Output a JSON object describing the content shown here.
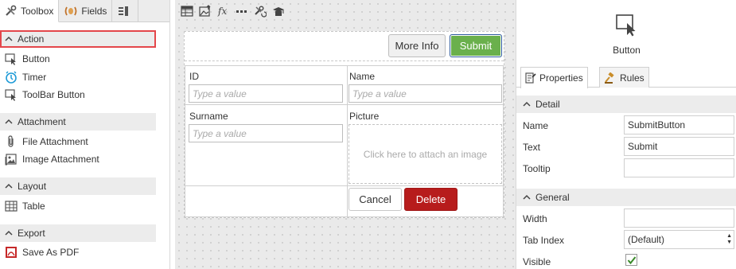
{
  "left_panel": {
    "tabs": [
      {
        "label": "Toolbox",
        "icon": "tools-icon"
      },
      {
        "label": "Fields",
        "icon": "fields-icon"
      },
      {
        "label": "",
        "icon": "list-icon"
      }
    ],
    "sections": [
      {
        "title": "Action",
        "items": [
          "Button",
          "Timer",
          "ToolBar Button"
        ]
      },
      {
        "title": "Attachment",
        "items": [
          "File Attachment",
          "Image Attachment"
        ]
      },
      {
        "title": "Layout",
        "items": [
          "Table"
        ]
      },
      {
        "title": "Export",
        "items": [
          "Save As PDF"
        ]
      }
    ]
  },
  "toolbar": {
    "icons": [
      "table-icon",
      "image-upload-icon",
      "fx-icon",
      "ellipsis-icon",
      "tools-refresh-icon",
      "graduate-icon"
    ]
  },
  "form": {
    "more_info_label": "More Info",
    "submit_label": "Submit",
    "id_label": "ID",
    "id_placeholder": "Type a value",
    "name_label": "Name",
    "name_placeholder": "Type a value",
    "surname_label": "Surname",
    "surname_placeholder": "Type a value",
    "picture_label": "Picture",
    "picture_placeholder": "Click here to attach an image",
    "cancel_label": "Cancel",
    "delete_label": "Delete"
  },
  "right_panel": {
    "control_label": "Button",
    "tabs": {
      "properties": "Properties",
      "rules": "Rules"
    },
    "detail_title": "Detail",
    "general_title": "General",
    "name_label": "Name",
    "name_value": "SubmitButton",
    "text_label": "Text",
    "text_value": "Submit",
    "tooltip_label": "Tooltip",
    "tooltip_value": "",
    "width_label": "Width",
    "width_value": "",
    "tabindex_label": "Tab Index",
    "tabindex_value": "(Default)",
    "visible_label": "Visible",
    "visible_checked": true
  },
  "colors": {
    "submit": "#6ab04c",
    "delete": "#b71c1c",
    "highlight": "#e4474b",
    "timer": "#1e9bd7",
    "pdf": "#c62828"
  }
}
